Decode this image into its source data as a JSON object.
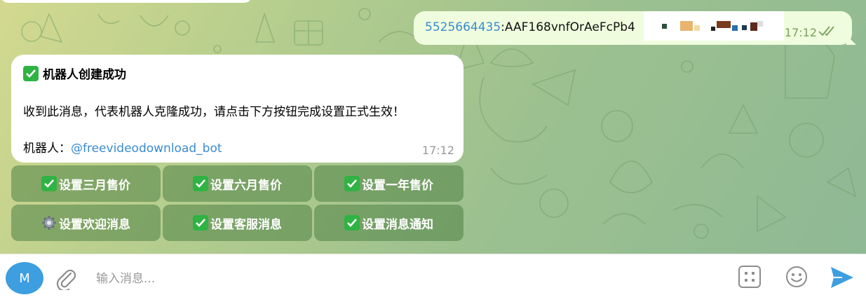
{
  "outgoing": {
    "user_id": "5525664435",
    "text": ":AAF168vnfOrAeFcPb4",
    "time": "17:12"
  },
  "incoming": {
    "title": "机器人创建成功",
    "body": "收到此消息，代表机器人克隆成功，请点击下方按钮完成设置正式生效！",
    "bot_label": "机器人：",
    "bot_handle": "@freevideodownload_bot",
    "time": "17:12"
  },
  "keyboard": [
    {
      "icon": "check-mark-icon",
      "label": "设置三月售价"
    },
    {
      "icon": "check-mark-icon",
      "label": "设置六月售价"
    },
    {
      "icon": "check-mark-icon",
      "label": "设置一年售价"
    },
    {
      "icon": "gear-icon",
      "label": "设置欢迎消息"
    },
    {
      "icon": "check-mark-icon",
      "label": "设置客服消息"
    },
    {
      "icon": "check-mark-icon",
      "label": "设置消息通知"
    }
  ],
  "input_bar": {
    "avatar_letter": "M",
    "placeholder": "输入消息..."
  },
  "colors": {
    "accent": "#3a8bd0",
    "check_green": "#2fb344",
    "outgoing_bg": "#effdde",
    "avatar_bg": "#3d9ee0"
  }
}
